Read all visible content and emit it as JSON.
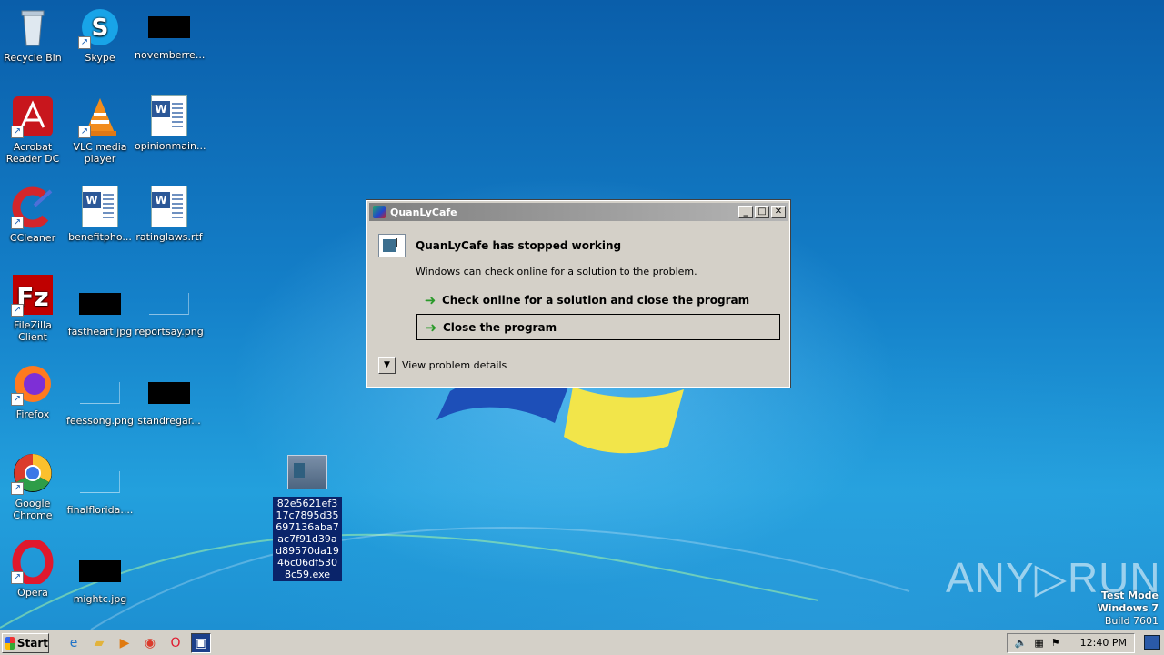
{
  "desktop": {
    "icons": [
      {
        "label": "Recycle Bin",
        "icon": "recycle-bin-icon"
      },
      {
        "label": "Skype",
        "icon": "skype-icon"
      },
      {
        "label": "novemberre...",
        "icon": "black-thumbnail-icon"
      },
      {
        "label": "Acrobat Reader DC",
        "icon": "acrobat-icon"
      },
      {
        "label": "VLC media player",
        "icon": "vlc-icon"
      },
      {
        "label": "opinionmain...",
        "icon": "word-doc-icon"
      },
      {
        "label": "CCleaner",
        "icon": "ccleaner-icon"
      },
      {
        "label": "benefitpho...",
        "icon": "word-doc-icon"
      },
      {
        "label": "ratinglaws.rtf",
        "icon": "word-doc-icon"
      },
      {
        "label": "FileZilla Client",
        "icon": "filezilla-icon"
      },
      {
        "label": "fastheart.jpg",
        "icon": "black-thumbnail-icon"
      },
      {
        "label": "reportsay.png",
        "icon": "blank-thumbnail-icon"
      },
      {
        "label": "Firefox",
        "icon": "firefox-icon"
      },
      {
        "label": "feessong.png",
        "icon": "blank-thumbnail-icon"
      },
      {
        "label": "standregar...",
        "icon": "black-thumbnail-icon"
      },
      {
        "label": "Google Chrome",
        "icon": "chrome-icon"
      },
      {
        "label": "finalflorida....",
        "icon": "blank-thumbnail-icon"
      },
      {
        "label": "Opera",
        "icon": "opera-icon"
      },
      {
        "label": "mightc.jpg",
        "icon": "black-thumbnail-icon"
      }
    ],
    "selected_exe": "82e5621ef317c7895d35697136aba7ac7f91d39ad89570da1946c06df5308c59.exe"
  },
  "dialog": {
    "title": "QuanLyCafe",
    "heading": "QuanLyCafe has stopped working",
    "subtext": "Windows can check online for a solution to the problem.",
    "action_check": "Check online for a solution and close the program",
    "action_close": "Close the program",
    "details": "View problem details",
    "title_buttons": {
      "minimize": "_",
      "maximize": "□",
      "close": "✕"
    }
  },
  "watermark": {
    "text": "ANY▷RUN"
  },
  "testmode": {
    "line1": "Test Mode",
    "line2": "Windows 7",
    "line3": "Build 7601"
  },
  "taskbar": {
    "start_label": "Start",
    "clock": "12:40 PM"
  },
  "colors": {
    "dialog_bg": "#d4d0c8",
    "selection": "#0a246a",
    "desktop": "#1480c9"
  }
}
